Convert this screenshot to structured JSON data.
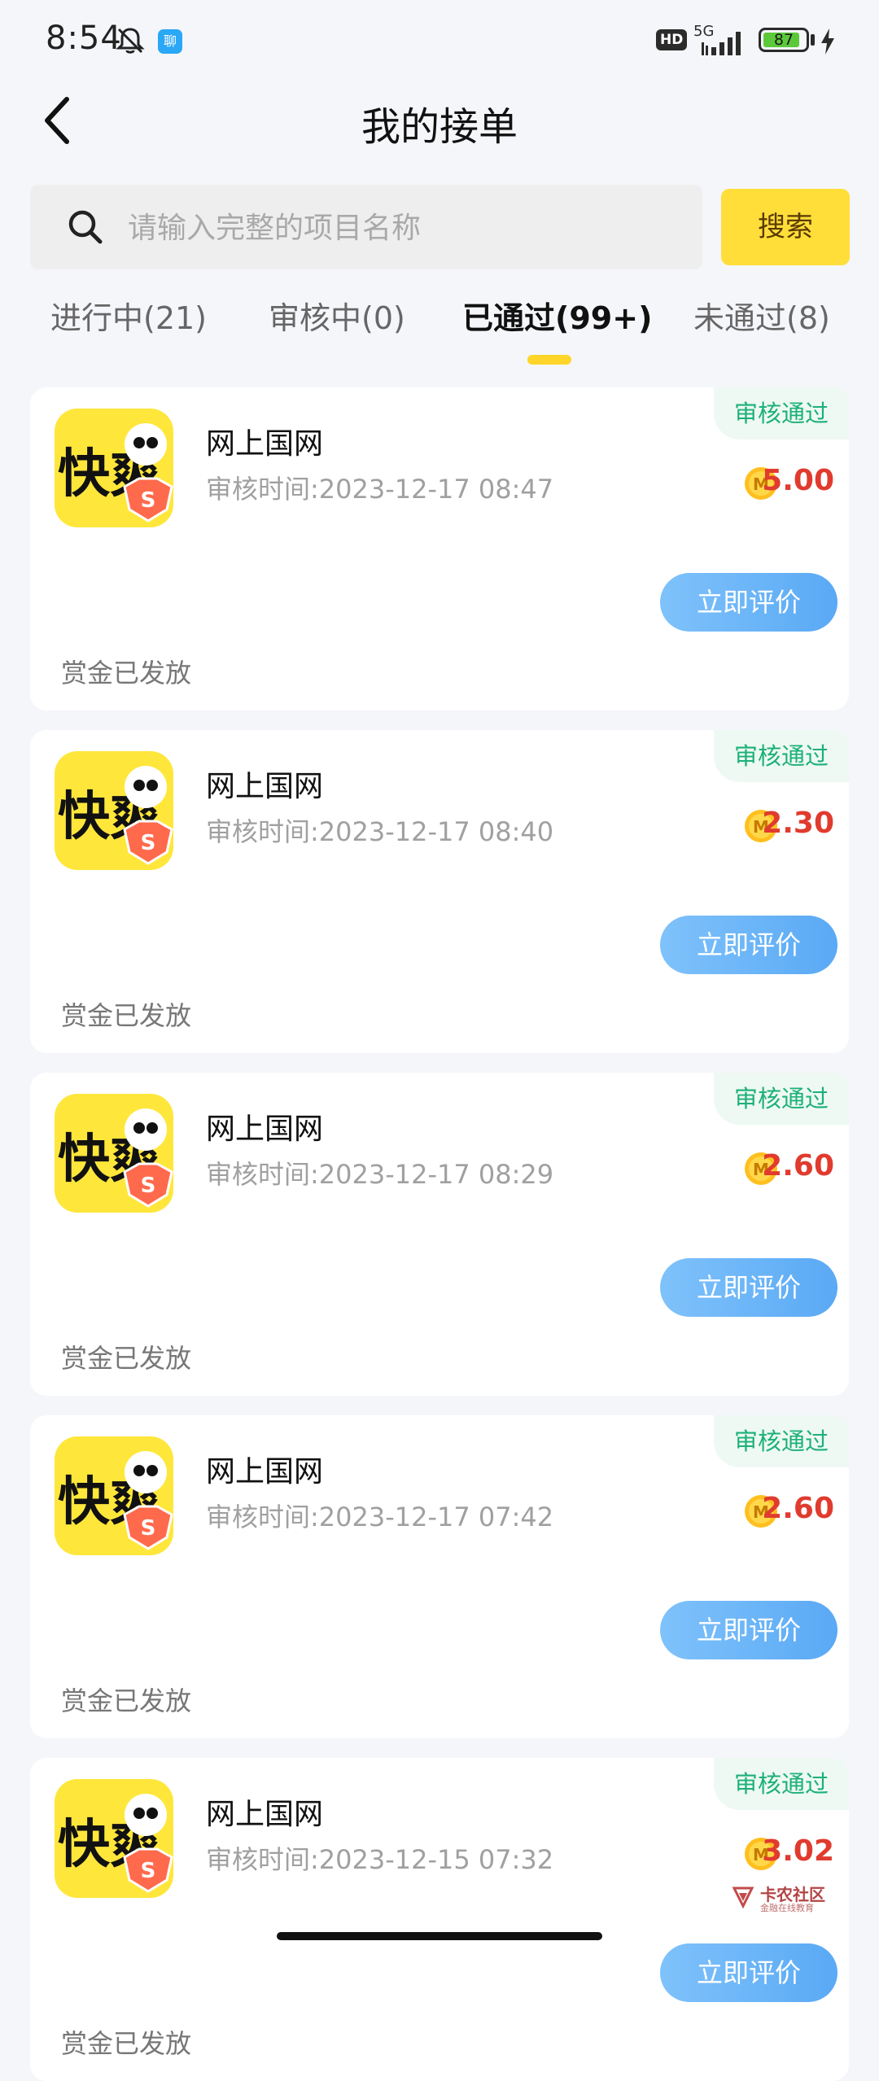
{
  "status_bar": {
    "time": "8:54",
    "app_badge": "聊",
    "hd": "HD",
    "network": "5G",
    "battery": "87",
    "battery_level": 0.87
  },
  "header": {
    "title": "我的接单"
  },
  "search": {
    "placeholder": "请输入完整的项目名称",
    "value": "",
    "button": "搜索"
  },
  "tabs": [
    {
      "label": "进行中(21)"
    },
    {
      "label": "审核中(0)"
    },
    {
      "label": "已通过(99+)",
      "active": true
    },
    {
      "label": "未通过(8)"
    }
  ],
  "cards": [
    {
      "status": "审核通过",
      "title": "网上国网",
      "time": "审核时间:2023-12-17 08:47",
      "reward": "5.00",
      "button": "立即评价",
      "footer": "赏金已发放"
    },
    {
      "status": "审核通过",
      "title": "网上国网",
      "time": "审核时间:2023-12-17 08:40",
      "reward": "2.30",
      "button": "立即评价",
      "footer": "赏金已发放"
    },
    {
      "status": "审核通过",
      "title": "网上国网",
      "time": "审核时间:2023-12-17 08:29",
      "reward": "2.60",
      "button": "立即评价",
      "footer": "赏金已发放"
    },
    {
      "status": "审核通过",
      "title": "网上国网",
      "time": "审核时间:2023-12-17 07:42",
      "reward": "2.60",
      "button": "立即评价",
      "footer": "赏金已发放"
    },
    {
      "status": "审核通过",
      "title": "网上国网",
      "time": "审核时间:2023-12-15 07:32",
      "reward": "3.02",
      "button": "立即评价",
      "footer": "赏金已发放"
    }
  ],
  "app_icon": {
    "logo_text": "快爽",
    "badge": "S",
    "name": "kuaishuang-app-icon"
  },
  "watermark": {
    "text": "卡农社区",
    "sub": "金融在线教育"
  },
  "colors": {
    "accent_yellow": "#ffde3a",
    "status_green": "#1db07a",
    "reward_red": "#e03b2e",
    "button_blue": "#5aa9f5",
    "background": "#f5f6fa"
  }
}
